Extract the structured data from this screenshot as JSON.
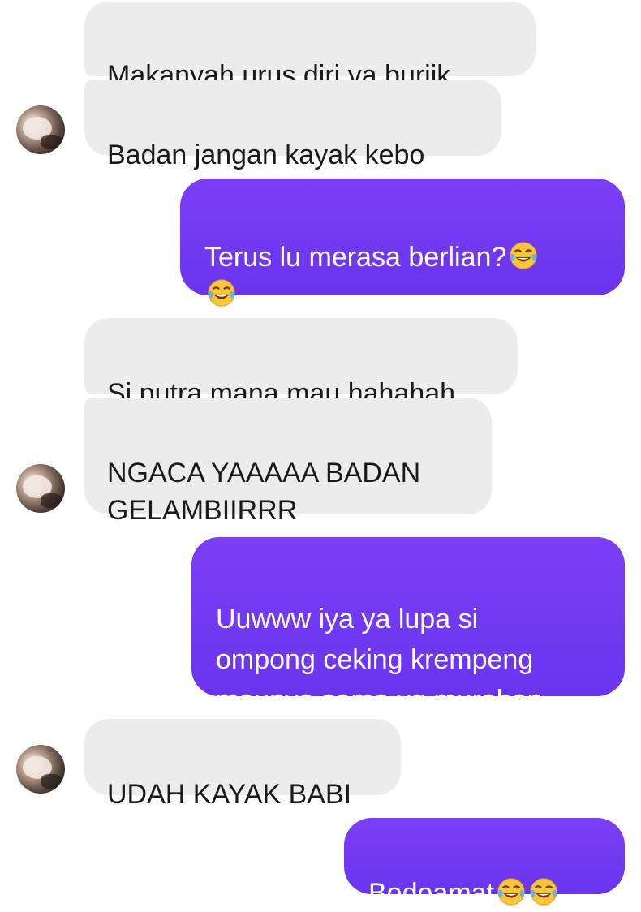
{
  "conversation": {
    "messages": [
      {
        "side": "in",
        "text": "Makanyah urus diri ya buriik"
      },
      {
        "side": "in",
        "text": "Badan jangan kayak kebo"
      },
      {
        "side": "out",
        "text": "Terus lu merasa berlian?",
        "emoji": "face-with-tears-of-joy"
      },
      {
        "side": "in",
        "text": "Si putra mana mau hahahah"
      },
      {
        "side": "in",
        "text": "NGACA YAAAAA BADAN\nGELAMBIIRRR"
      },
      {
        "side": "out",
        "text": "Uuwww iya ya lupa si\nompong ceking krempeng\nmaunya sama yg murahan"
      },
      {
        "side": "in",
        "text": "UDAH KAYAK BABI"
      },
      {
        "side": "out",
        "text": "Bodoamat",
        "emoji": "face-with-tears-of-joy"
      }
    ]
  },
  "colors": {
    "incoming_bubble": "#ececec",
    "outgoing_bubble": "#7040f2",
    "outgoing_text": "#ffffff",
    "incoming_text": "#1a1a1a"
  }
}
